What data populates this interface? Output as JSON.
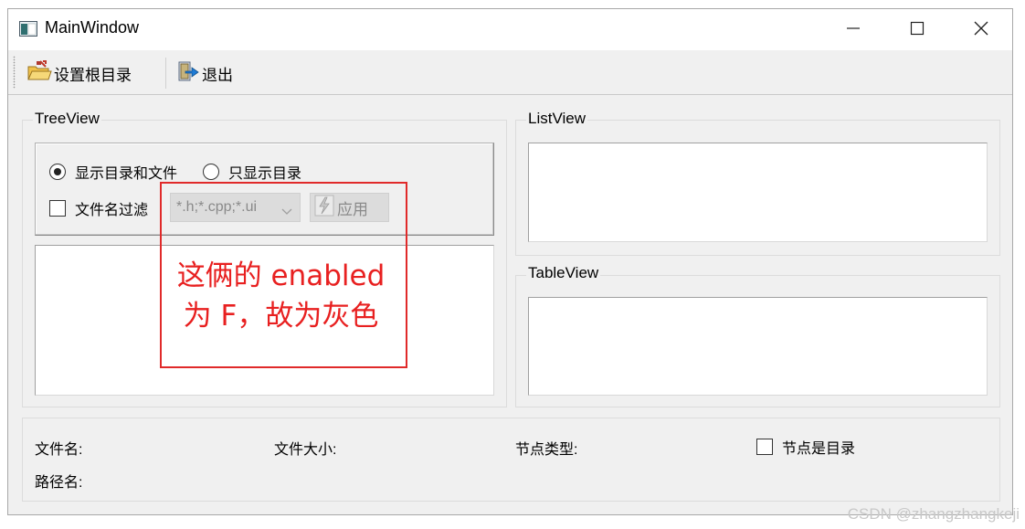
{
  "window": {
    "title": "MainWindow",
    "icon": "app-window-icon"
  },
  "window_controls": {
    "minimize": "minimize-icon",
    "maximize": "maximize-icon",
    "close": "close-icon"
  },
  "toolbar": {
    "set_root_label": "设置根目录",
    "exit_label": "退出"
  },
  "tree_group": {
    "title": "TreeView",
    "radio_dirs_files": "显示目录和文件",
    "radio_dirs_only": "只显示目录",
    "radio_selected": "显示目录和文件",
    "filter_checkbox": "文件名过滤",
    "filter_value": "*.h;*.cpp;*.ui",
    "apply_button": "应用",
    "filter_enabled": false
  },
  "list_group": {
    "title": "ListView"
  },
  "table_group": {
    "title": "TableView"
  },
  "info": {
    "file_name": "文件名:",
    "file_size": "文件大小:",
    "node_type": "节点类型:",
    "is_dir_checkbox": "节点是目录",
    "path_name": "路径名:"
  },
  "annotation": {
    "line1": "这俩的 enabled",
    "line2": "为 F，故为灰色",
    "color": "#e82020"
  },
  "watermark": "CSDN @zhangzhangkeji"
}
